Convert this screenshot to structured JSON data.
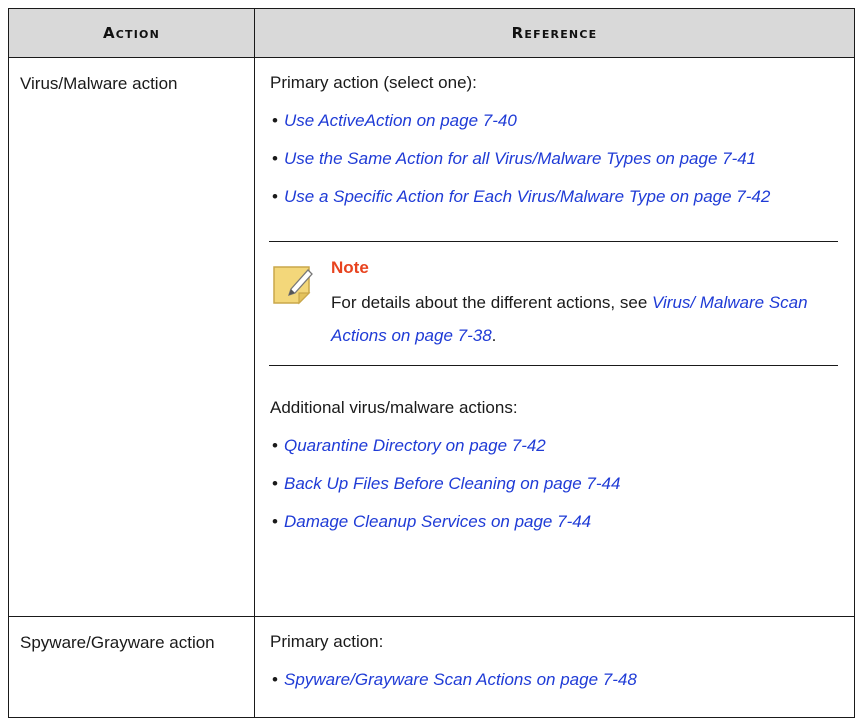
{
  "table": {
    "headers": {
      "action": "Action",
      "reference": "Reference"
    },
    "rows": [
      {
        "action": "Virus/Malware action",
        "primary_lead": "Primary action (select one):",
        "primary_links": [
          "Use ActiveAction on page 7-40",
          "Use the Same Action for all Virus/Malware Types on page 7-41",
          "Use a Specific Action for Each Virus/Malware Type on page 7-42"
        ],
        "note": {
          "title": "Note",
          "text_prefix": "For details about the different actions, see ",
          "link": "Virus/ Malware Scan Actions on page 7-38",
          "text_suffix": "."
        },
        "additional_lead": "Additional virus/malware actions:",
        "additional_links": [
          "Quarantine Directory on page 7-42",
          "Back Up Files Before Cleaning on page 7-44",
          "Damage Cleanup Services on page 7-44"
        ]
      },
      {
        "action": "Spyware/Grayware action",
        "primary_lead": "Primary action:",
        "primary_links": [
          "Spyware/Grayware Scan Actions on page 7-48"
        ]
      }
    ]
  },
  "colors": {
    "header_bg": "#d9d9d9",
    "link": "#1f3bd6",
    "note_title": "#e8431f",
    "note_icon": "#f3d77a"
  },
  "icons": {
    "note": "note-pencil-icon",
    "bullet": "bullet"
  }
}
